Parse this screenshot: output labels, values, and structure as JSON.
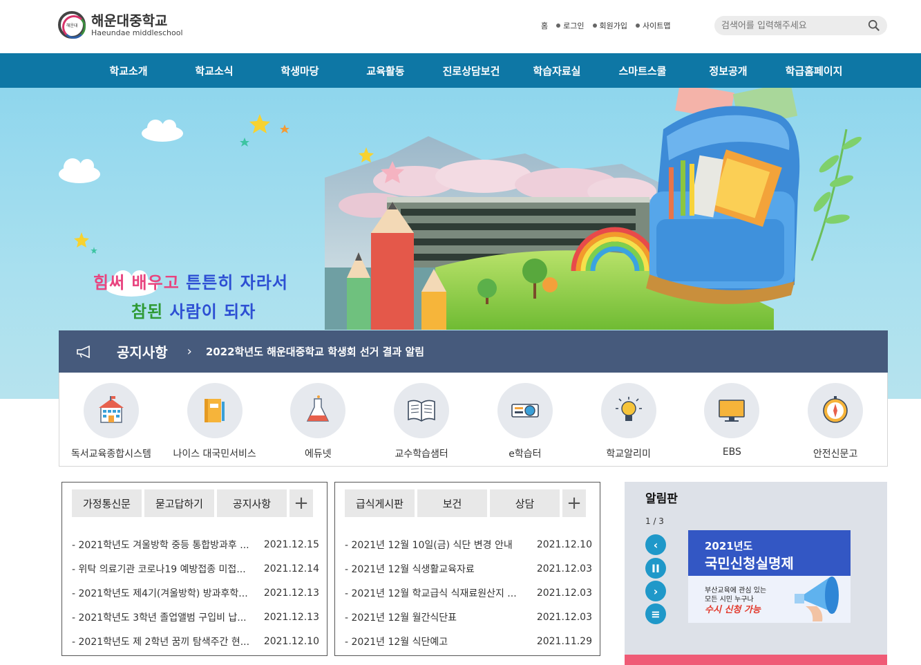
{
  "header": {
    "logo_badge": "해운대",
    "school_name": "해운대중학교",
    "school_name_en": "Haeundae middleschool",
    "util": [
      "홈",
      "로그인",
      "회원가입",
      "사이트맵"
    ],
    "search_placeholder": "검색어를 입력해주세요"
  },
  "gnb": [
    "학교소개",
    "학교소식",
    "학생마당",
    "교육활동",
    "진로상담보건",
    "학습자료실",
    "스마트스쿨",
    "정보공개",
    "학급홈페이지"
  ],
  "banner": {
    "slogan_line1": [
      "힘써",
      "배우고",
      "튼튼히",
      "자라서"
    ],
    "slogan_line2": [
      "참된",
      "사람이",
      "되자"
    ]
  },
  "notice_bar": {
    "title": "공지사항",
    "text": "2022학년도 해운대중학교 학생회 선거 결과 알림"
  },
  "quick_links": [
    {
      "label": "독서교육종합시스템",
      "icon": "school-icon"
    },
    {
      "label": "나이스 대국민서비스",
      "icon": "book-icon"
    },
    {
      "label": "에듀넷",
      "icon": "flask-icon"
    },
    {
      "label": "교수학습샘터",
      "icon": "open-book-icon"
    },
    {
      "label": "e학습터",
      "icon": "projector-icon"
    },
    {
      "label": "학교알리미",
      "icon": "lightbulb-icon"
    },
    {
      "label": "EBS",
      "icon": "monitor-icon"
    },
    {
      "label": "안전신문고",
      "icon": "compass-icon"
    }
  ],
  "board1": {
    "tabs": [
      "가정통신문",
      "묻고답하기",
      "공지사항"
    ],
    "rows": [
      {
        "title": "- 2021학년도 겨울방학 중등 통합방과후 ...",
        "date": "2021.12.15"
      },
      {
        "title": "- 위탁 의료기관 코로나19 예방접종 미접...",
        "date": "2021.12.14"
      },
      {
        "title": "- 2021학년도 제4기(겨울방학) 방과후학...",
        "date": "2021.12.13"
      },
      {
        "title": "- 2021학년도 3학년 졸업앨범 구입비 납...",
        "date": "2021.12.13"
      },
      {
        "title": "- 2021학년도 제 2학년 꿈끼 탐색주간 현...",
        "date": "2021.12.10"
      }
    ]
  },
  "board2": {
    "tabs": [
      "급식게시판",
      "보건",
      "상담"
    ],
    "rows": [
      {
        "title": "- 2021년 12월 10일(금) 식단 변경 안내",
        "date": "2021.12.10"
      },
      {
        "title": "- 2021년 12월 식생활교육자료",
        "date": "2021.12.03"
      },
      {
        "title": "- 2021년 12월 학교급식 식재료원산지 ...",
        "date": "2021.12.03"
      },
      {
        "title": "- 2021년 12월 월간식단표",
        "date": "2021.12.03"
      },
      {
        "title": "- 2021년 12월 식단예고",
        "date": "2021.11.29"
      }
    ]
  },
  "alim": {
    "title": "알림판",
    "page": "1 / 3",
    "slide": {
      "year": "2021년도",
      "headline": "국민신청실명제",
      "sub1": "부산교육에 관심 있는",
      "sub2": "모든 시민 누구나",
      "sub3": "수시 신청 가능"
    }
  },
  "colors": {
    "gnb": "#0e77a5",
    "notice_bar": "#465a7c",
    "control": "#1f98c9",
    "slogan_pink": "#e8447f",
    "slogan_blue": "#2d4fd3",
    "slogan_green": "#2f9a35"
  }
}
